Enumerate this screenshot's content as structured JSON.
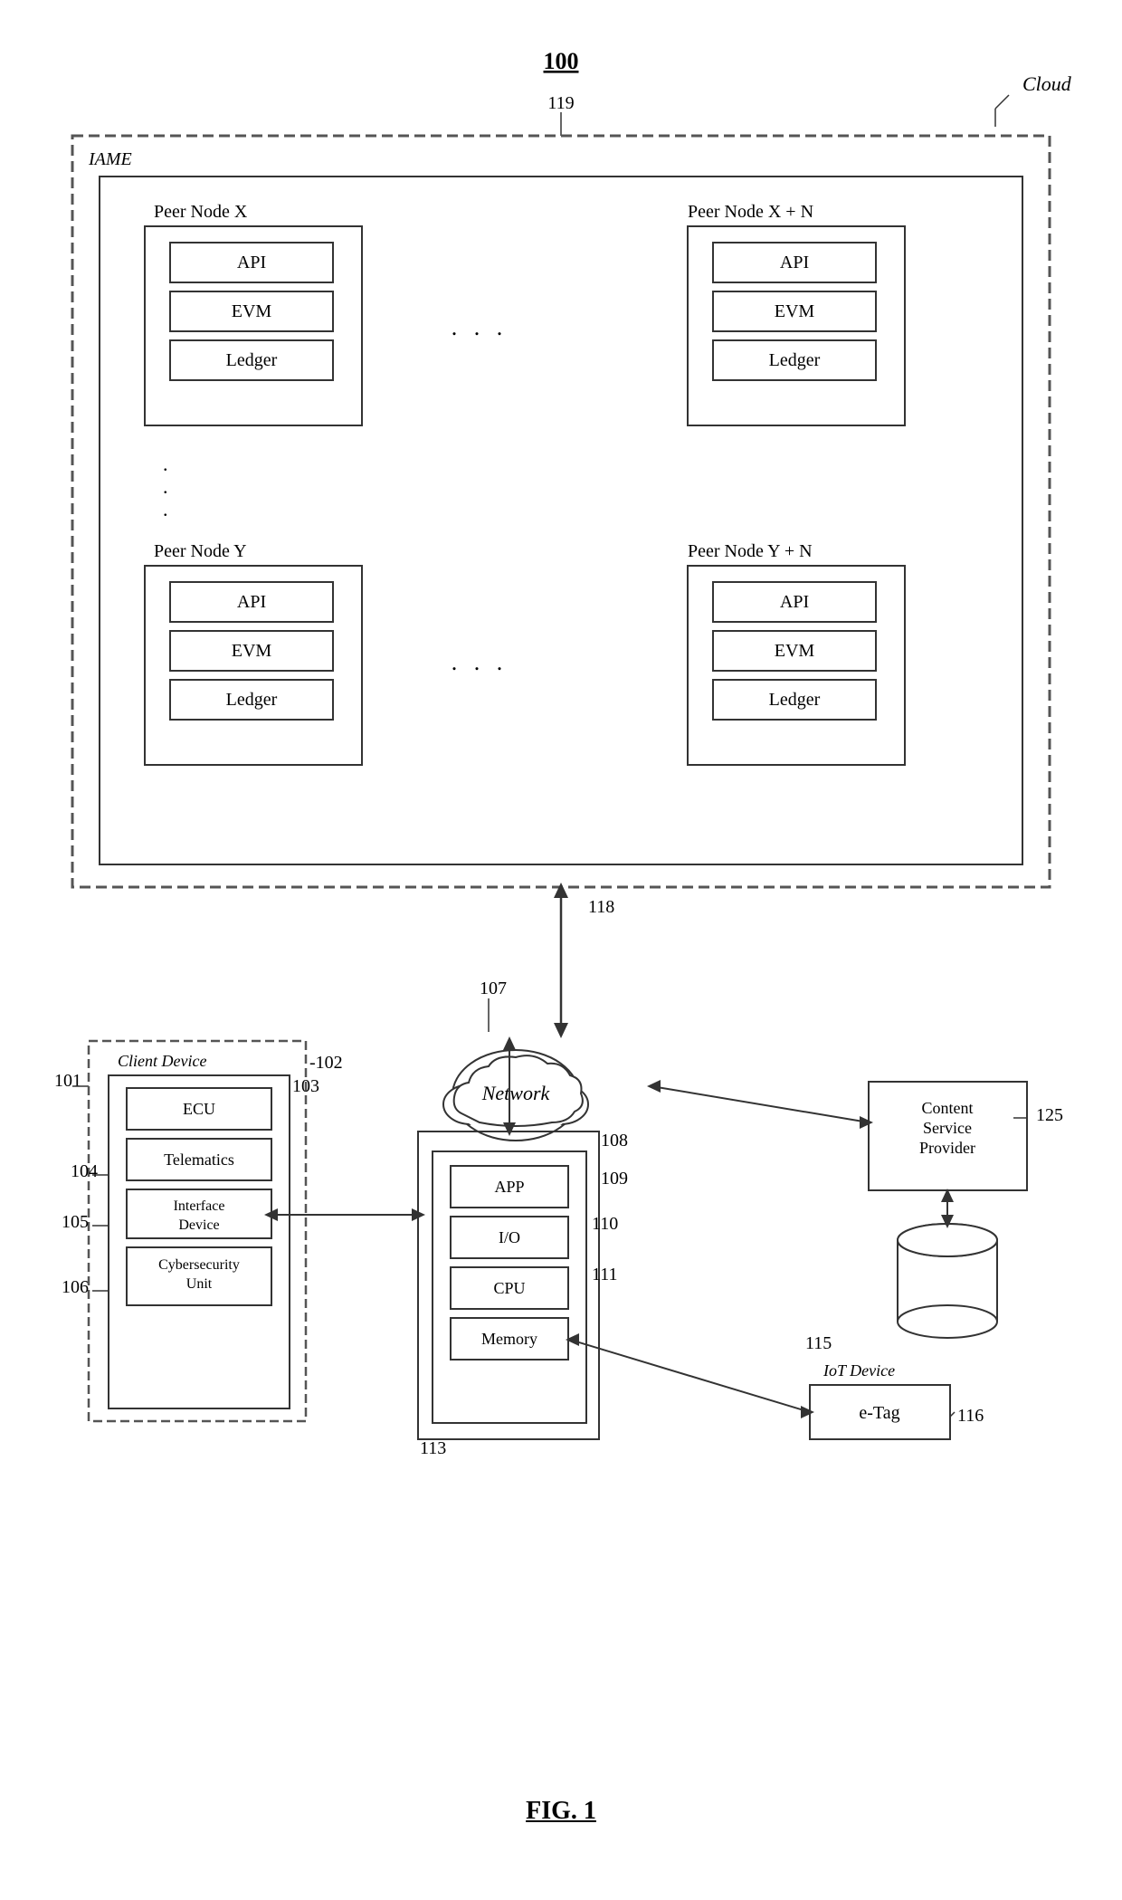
{
  "diagram": {
    "figure_number": "FIG. 1",
    "top_ref": "100",
    "cloud_label": "Cloud",
    "iame_label": "IAME",
    "ref_119": "119",
    "ref_118": "118",
    "peer_nodes": {
      "node_x_label": "Peer Node X",
      "node_xn_label": "Peer Node X + N",
      "node_y_label": "Peer Node Y",
      "node_yn_label": "Peer Node Y + N",
      "components": [
        "API",
        "EVM",
        "Ledger"
      ]
    },
    "client_device": {
      "outer_label": "Client Device",
      "ref_101": "101",
      "ref_102": "102",
      "inner_ref": "103",
      "components": [
        {
          "label": "ECU",
          "ref": ""
        },
        {
          "label": "Telematics",
          "ref": "104"
        },
        {
          "label": "Interface Device",
          "ref": "105"
        },
        {
          "label": "Cybersecurity Unit",
          "ref": "106"
        }
      ]
    },
    "gateway": {
      "ref_107": "107",
      "ref_108": "108",
      "ref_109": "109",
      "ref_110": "110",
      "ref_111": "111",
      "ref_113": "113",
      "components": [
        {
          "label": "APP"
        },
        {
          "label": "I/O"
        },
        {
          "label": "CPU"
        },
        {
          "label": "Memory"
        }
      ]
    },
    "network": {
      "label": "Network",
      "ref": "118"
    },
    "csp": {
      "label": "Content\nService\nProvider",
      "ref": "125"
    },
    "iot": {
      "label": "IoT Device",
      "ref_115": "115",
      "ref_116": "116",
      "component": "e-Tag"
    }
  }
}
